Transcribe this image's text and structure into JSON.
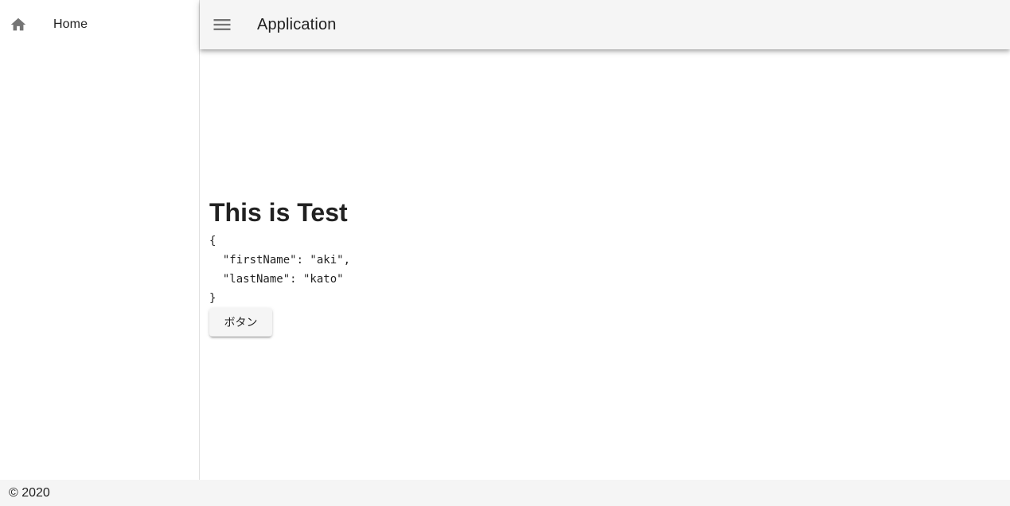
{
  "sidebar": {
    "items": [
      {
        "label": "Home",
        "icon": "home-icon"
      }
    ]
  },
  "header": {
    "title": "Application",
    "menu_icon": "menu-icon"
  },
  "main": {
    "heading": "This is Test",
    "json_lines": [
      "{",
      "  \"firstName\": \"aki\",",
      "  \"lastName\": \"kato\"",
      "}"
    ],
    "button_label": "ボタン"
  },
  "footer": {
    "text": "© 2020"
  },
  "colors": {
    "appbar_bg": "#f5f5f5",
    "footer_bg": "#f5f5f5",
    "icon": "#757575",
    "text": "#212121"
  }
}
